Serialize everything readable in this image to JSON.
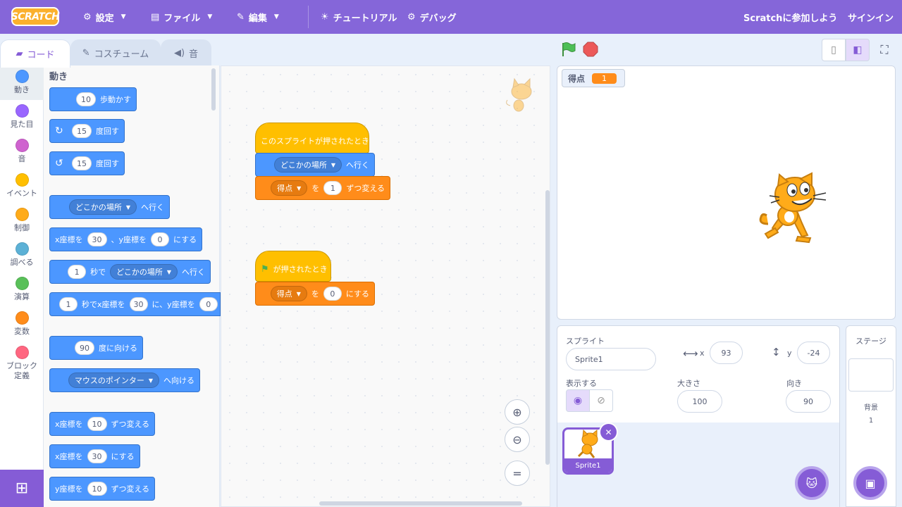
{
  "menubar": {
    "logo": "SCRATCH",
    "settings": "設定",
    "file": "ファイル",
    "edit": "編集",
    "tutorials": "チュートリアル",
    "debug": "デバッグ",
    "join": "Scratchに参加しよう",
    "signin": "サインイン"
  },
  "tabs": {
    "code": "コード",
    "costumes": "コスチューム",
    "sounds": "音"
  },
  "categories": [
    {
      "label": "動き",
      "color": "#4c97ff"
    },
    {
      "label": "見た目",
      "color": "#9966ff"
    },
    {
      "label": "音",
      "color": "#cf63cf"
    },
    {
      "label": "イベント",
      "color": "#ffbf00"
    },
    {
      "label": "制御",
      "color": "#ffab19"
    },
    {
      "label": "調べる",
      "color": "#5cb1d6"
    },
    {
      "label": "演算",
      "color": "#59c059"
    },
    {
      "label": "変数",
      "color": "#ff8c1a"
    },
    {
      "label": "ブロック定義",
      "color": "#ff6680"
    }
  ],
  "palette": {
    "section": "動き",
    "move": {
      "n": "10",
      "t": "歩動かす"
    },
    "turn_right": {
      "n": "15",
      "t": "度回す"
    },
    "turn_left": {
      "n": "15",
      "t": "度回す"
    },
    "goto": {
      "dd": "どこかの場所",
      "t": "へ行く"
    },
    "goto_xy": {
      "a": "x座標を",
      "x": "30",
      "b": "、y座標を",
      "y": "0",
      "c": "にする"
    },
    "glide": {
      "n": "1",
      "a": "秒で",
      "dd": "どこかの場所",
      "b": "へ行く"
    },
    "glide_xy": {
      "n": "1",
      "a": "秒でx座標を",
      "x": "30",
      "b": "に、y座標を",
      "y": "0"
    },
    "point": {
      "n": "90",
      "t": "度に向ける"
    },
    "point_towards": {
      "dd": "マウスのポインター",
      "t": "へ向ける"
    },
    "change_x": {
      "a": "x座標を",
      "n": "10",
      "b": "ずつ変える"
    },
    "set_x": {
      "a": "x座標を",
      "n": "30",
      "b": "にする"
    },
    "change_y": {
      "a": "y座標を",
      "n": "10",
      "b": "ずつ変える"
    }
  },
  "scripts": {
    "s1_hat": "このスプライトが押されたとき",
    "s1_goto_dd": "どこかの場所",
    "s1_goto_t": "へ行く",
    "s1_var_dd": "得点",
    "s1_wo": "を",
    "s1_n": "1",
    "s1_t": "ずつ変える",
    "s2_hat": "が押されたとき",
    "s2_var_dd": "得点",
    "s2_wo": "を",
    "s2_n": "0",
    "s2_t": "にする"
  },
  "stage": {
    "monitor_label": "得点",
    "monitor_value": "1"
  },
  "sprite_info": {
    "sprite_label": "スプライト",
    "sprite_name": "Sprite1",
    "x_label": "x",
    "x": "93",
    "y_label": "y",
    "y": "-24",
    "show_label": "表示する",
    "size_label": "大きさ",
    "size": "100",
    "direction_label": "向き",
    "direction": "90",
    "thumb_name": "Sprite1"
  },
  "stage_pane": {
    "title": "ステージ",
    "backdrop_label": "背景",
    "backdrop_count": "1"
  }
}
